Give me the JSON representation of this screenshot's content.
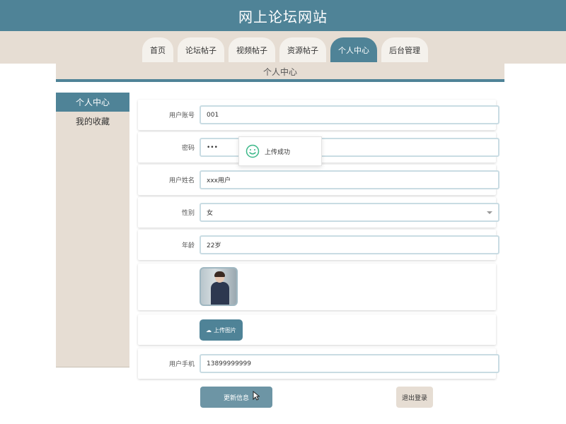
{
  "site": {
    "title": "网上论坛网站"
  },
  "nav": {
    "tabs": [
      {
        "label": "首页",
        "active": false
      },
      {
        "label": "论坛帖子",
        "active": false
      },
      {
        "label": "视频帖子",
        "active": false
      },
      {
        "label": "资源帖子",
        "active": false
      },
      {
        "label": "个人中心",
        "active": true
      },
      {
        "label": "后台管理",
        "active": false
      }
    ]
  },
  "breadcrumb": {
    "title": "个人中心"
  },
  "sidebar": {
    "items": [
      {
        "label": "个人中心",
        "active": true
      },
      {
        "label": "我的收藏",
        "active": false
      }
    ]
  },
  "form": {
    "account": {
      "label": "用户账号",
      "value": "001"
    },
    "password": {
      "label": "密码",
      "value": "•••"
    },
    "name": {
      "label": "用户姓名",
      "value": "xxx用户"
    },
    "gender": {
      "label": "性别",
      "value": "女"
    },
    "age": {
      "label": "年龄",
      "value": "22岁"
    },
    "upload": {
      "label": "上传图片",
      "icon": "cloud-upload-icon"
    },
    "phone": {
      "label": "用户手机",
      "value": "13899999999"
    }
  },
  "actions": {
    "update_label": "更新信息",
    "logout_label": "退出登录"
  },
  "toast": {
    "text": "上传成功",
    "icon": "smile-icon"
  },
  "colors": {
    "primary": "#4f8397",
    "beige": "#e6ddd3",
    "field_border": "#c9dce3",
    "toast_icon": "#3cb889"
  }
}
